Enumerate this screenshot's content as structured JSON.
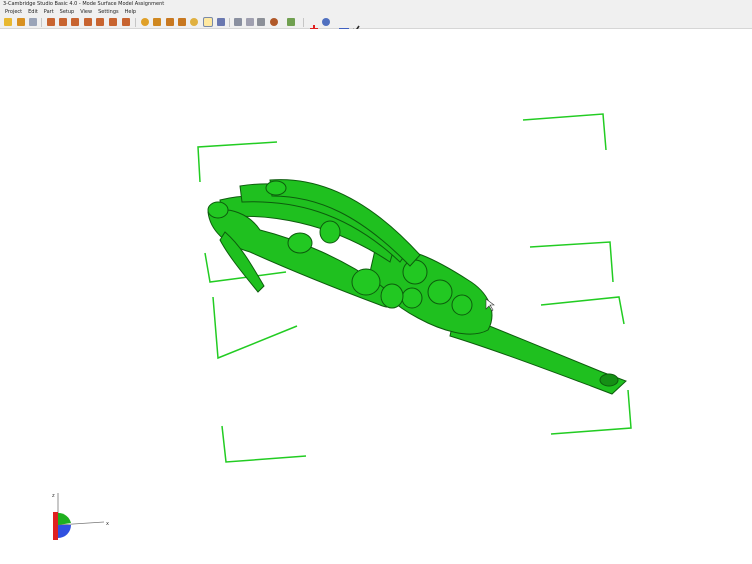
{
  "window": {
    "title": "3-Cambridge Studio Basic 4.0 - Mode Surface Model Assignment"
  },
  "menu": [
    "Project",
    "Edit",
    "Part",
    "Setup",
    "View",
    "Settings",
    "Help"
  ],
  "toolbar": {
    "icons": [
      "open-folder-icon",
      "home-icon",
      "recent-icon",
      "cube-view-front-icon",
      "cube-view-back-icon",
      "cube-view-left-icon",
      "cube-view-right-icon",
      "cube-view-top-icon",
      "cube-view-bottom-icon",
      "rotate-icon",
      "pan-icon",
      "zoom-fit-icon",
      "zoom-window-icon",
      "zoom-icon",
      "select-icon",
      "pick-point-icon",
      "measure-icon",
      "eraser-icon",
      "layer-icon",
      "render-mode-icon",
      "display-options-icon",
      "add-icon",
      "camera-icon",
      "remove-icon",
      "confirm-icon"
    ]
  },
  "axes": {
    "x_label": "x",
    "z_label": "z"
  },
  "colors": {
    "model": "#1fc01f",
    "bounding_box": "#22cc22",
    "axis_red": "#e02020",
    "axis_blue": "#3050e0",
    "toolbar_bg": "#f0f0f0"
  }
}
